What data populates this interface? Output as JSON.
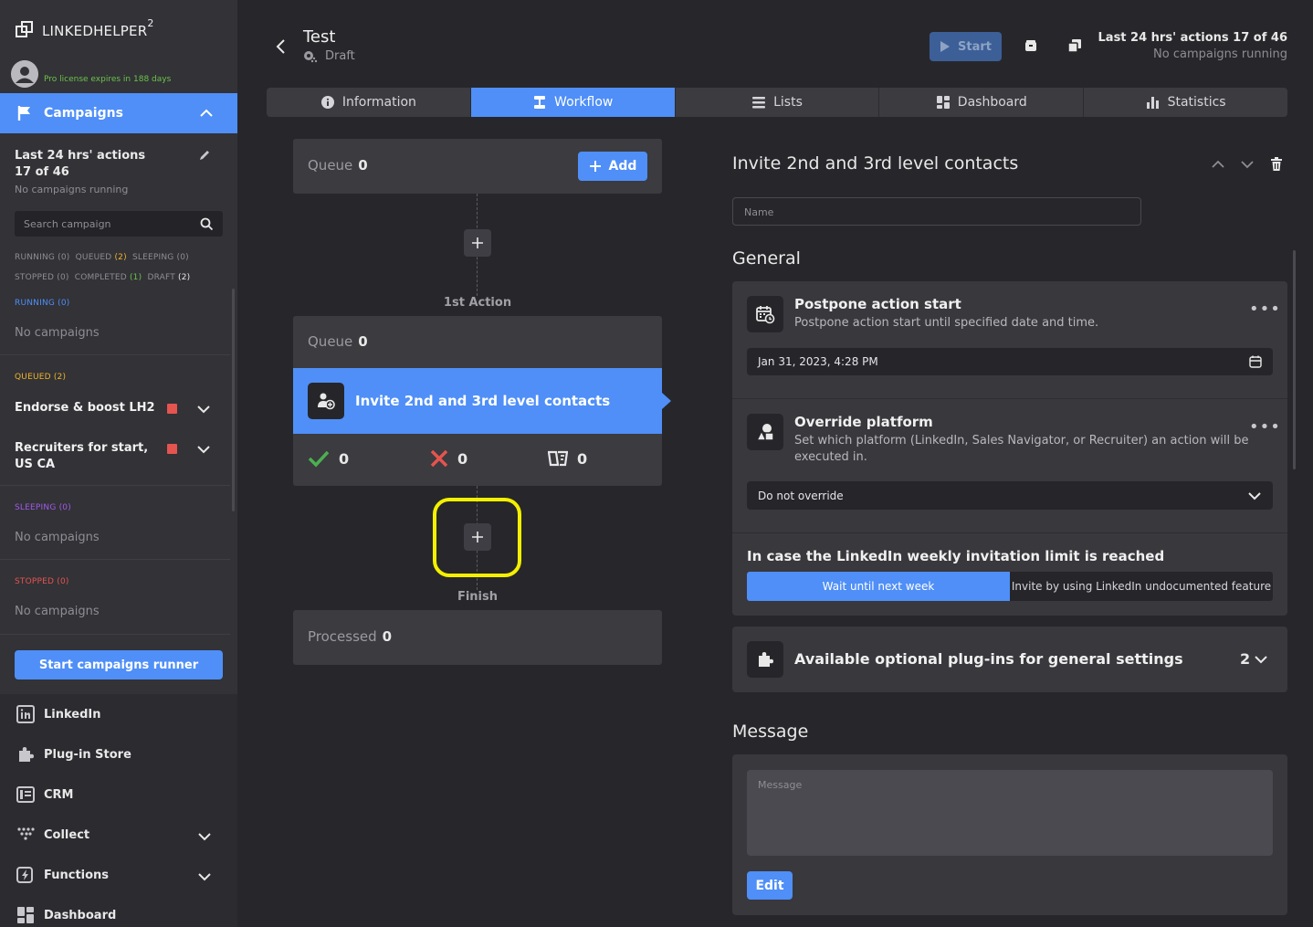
{
  "app": {
    "logo_text": "LINKEDHELPER",
    "logo_sup": "2",
    "license": "Pro license expires in 188 days"
  },
  "sidebar": {
    "campaigns_label": "Campaigns",
    "stats_line1": "Last 24 hrs' actions",
    "stats_line2": "17 of 46",
    "stats_sub": "No campaigns running",
    "search_placeholder": "Search campaign",
    "filters_row1": [
      {
        "label": "RUNNING",
        "count": "(0)",
        "color": "#8d8d93"
      },
      {
        "label": "QUEUED",
        "count": "(2)",
        "color": "#f0b429"
      },
      {
        "label": "SLEEPING",
        "count": "(0)",
        "color": "#8d8d93"
      }
    ],
    "filters_row2": [
      {
        "label": "STOPPED",
        "count": "(0)",
        "color": "#8d8d93"
      },
      {
        "label": "COMPLETED",
        "count": "(1)",
        "color": "#6cc24a"
      },
      {
        "label": "DRAFT",
        "count": "(2)",
        "color": "#e8e8e8"
      }
    ],
    "sections": {
      "running": {
        "title": "RUNNING",
        "count": "(0)",
        "empty": "No campaigns",
        "color": "#4f8ff7"
      },
      "queued": {
        "title": "QUEUED",
        "count": "(2)",
        "color": "#f0b429",
        "items": [
          "Endorse & boost LH2",
          "Recruiters for start,",
          "US CA"
        ]
      },
      "sleeping": {
        "title": "SLEEPING",
        "count": "(0)",
        "empty": "No campaigns",
        "color": "#a259e6"
      },
      "stopped": {
        "title": "STOPPED",
        "count": "(0)",
        "empty": "No campaigns",
        "color": "#e5544e"
      }
    },
    "runner_button": "Start campaigns runner",
    "nav": [
      "LinkedIn",
      "Plug-in Store",
      "CRM",
      "Collect",
      "Functions",
      "Dashboard"
    ]
  },
  "header": {
    "title": "Test",
    "status": "Draft",
    "start_label": "Start",
    "right_line1": "Last 24 hrs' actions 17 of 46",
    "right_line2": "No campaigns running"
  },
  "tabs": [
    "Information",
    "Workflow",
    "Lists",
    "Dashboard",
    "Statistics"
  ],
  "active_tab": "Workflow",
  "workflow": {
    "queue_label": "Queue",
    "queue_count": "0",
    "add_label": "Add",
    "first_action_caption": "1st Action",
    "action_queue_label": "Queue",
    "action_queue_count": "0",
    "action_name": "Invite 2nd and 3rd level contacts",
    "stats": {
      "success": "0",
      "failed": "0",
      "skipped": "0"
    },
    "finish_caption": "Finish",
    "processed_label": "Processed",
    "processed_count": "0"
  },
  "panel": {
    "title": "Invite 2nd and 3rd level contacts",
    "name_placeholder": "Name",
    "general_heading": "General",
    "postpone": {
      "title": "Postpone action start",
      "desc": "Postpone action start until specified date and time.",
      "value": "Jan 31, 2023, 4:28 PM"
    },
    "override": {
      "title": "Override platform",
      "desc_line1": "Set which platform (LinkedIn, Sales Navigator, or Recruiter) an action will be",
      "desc_line2": "executed in.",
      "value": "Do not override"
    },
    "limit": {
      "title": "In case the LinkedIn weekly invitation limit is reached",
      "option_on": "Wait until next week",
      "option_off": "Invite by using LinkedIn undocumented feature"
    },
    "plugins": {
      "title": "Available optional plug-ins for general settings",
      "count": "2"
    },
    "message_heading": "Message",
    "message_placeholder": "Message",
    "edit_label": "Edit"
  }
}
